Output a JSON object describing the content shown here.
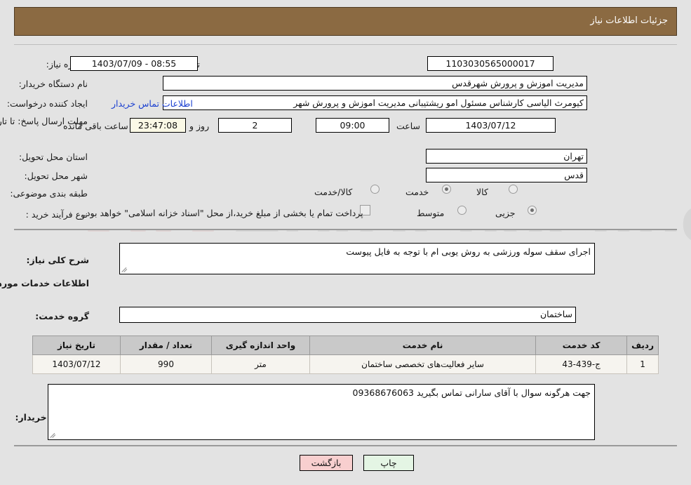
{
  "header": {
    "title": "جزئیات اطلاعات نیاز"
  },
  "watermark": {
    "text": "AriaTender.net",
    "logo": "shield-logo"
  },
  "form": {
    "need_number": {
      "label": "شماره نیاز:",
      "value": "1103030565000017"
    },
    "public_announce": {
      "label": "تاریخ و ساعت اعلان عمومی:",
      "value": "08:55 - 1403/07/09"
    },
    "buyer_org": {
      "label": "نام دستگاه خریدار:",
      "value": "مدیریت اموزش و پرورش شهرقدس"
    },
    "requester": {
      "label": "ایجاد کننده درخواست:",
      "value": "کیومرث الیاسی کارشناس مسئول امو ریشتیبانی  مدیریت اموزش و پرورش شهر",
      "contact_link": "اطلاعات تماس خریدار"
    },
    "deadline": {
      "label": "مهلت ارسال پاسخ: تا تاریخ:",
      "date": "1403/07/12",
      "time_label": "ساعت",
      "time": "09:00",
      "days": "2",
      "days_label": "روز و",
      "countdown": "23:47:08",
      "countdown_label": "ساعت باقی مانده"
    },
    "province": {
      "label": "استان محل تحویل:",
      "value": "تهران"
    },
    "city": {
      "label": "شهر محل تحویل:",
      "value": "قدس"
    },
    "category": {
      "label": "طبقه بندی موضوعی:",
      "options": [
        "کالا",
        "خدمت",
        "کالا/خدمت"
      ],
      "selected": "خدمت"
    },
    "purchase_type": {
      "label": "نوع فرآیند خرید :",
      "options": [
        "جزیی",
        "متوسط"
      ],
      "selected": "جزیی",
      "checkbox_note": "پرداخت تمام یا بخشی از مبلغ خرید،از محل \"اسناد خزانه اسلامی\" خواهد بود.",
      "checkbox_checked": false
    }
  },
  "description": {
    "label": "شرح کلی نیاز:",
    "value": "اجرای سقف سوله ورزشی به روش یوبی ام با توجه به فایل پیوست"
  },
  "services_section": {
    "heading": "اطلاعات خدمات مورد نیاز",
    "group_label": "گروه خدمت:",
    "group_value": "ساختمان"
  },
  "table": {
    "columns": [
      "ردیف",
      "کد خدمت",
      "نام خدمت",
      "واحد اندازه گیری",
      "تعداد / مقدار",
      "تاریخ نیاز"
    ],
    "rows": [
      {
        "row": "1",
        "code": "ج-439-43",
        "name": "سایر فعالیت‌های تخصصی ساختمان",
        "unit": "متر",
        "qty": "990",
        "date": "1403/07/12"
      }
    ]
  },
  "buyer_notes": {
    "label": "توضیحات خریدار:",
    "value": "جهت هرگونه سوال با آقای سارانی تماس بگیرید 09368676063"
  },
  "actions": {
    "print": "چاپ",
    "back": "بازگشت"
  },
  "colors": {
    "title_bar": "#8b6a42",
    "page_bg": "#e3e3e3",
    "link": "#1a3fd0",
    "print_btn": "#e4f5e4",
    "back_btn": "#f8cfcf",
    "table_header": "#c9c9c9",
    "highlight_field": "#fbf9e6"
  }
}
